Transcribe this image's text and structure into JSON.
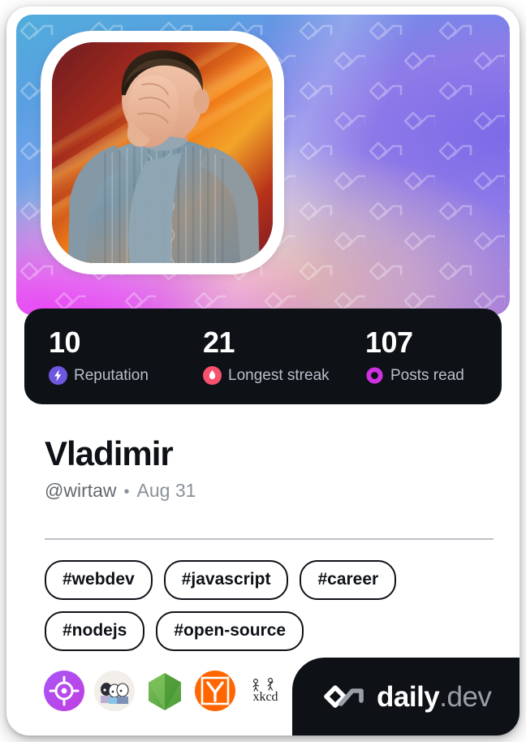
{
  "card": {
    "background_color": "#ffffff",
    "dark_color": "#0e1217"
  },
  "cover": {
    "watermark_icon": "daily-dev-logo-pattern",
    "gradient_colors": [
      "#3fb8d8",
      "#4f95e8",
      "#9a79e2",
      "#e949f5",
      "#ffc496"
    ]
  },
  "avatar": {
    "icon": "user-avatar-photo",
    "alt": "Person facepalming in a cable-knit sweater"
  },
  "stats": [
    {
      "value": "10",
      "label": "Reputation",
      "icon": "bolt-icon",
      "color": "#6e57e0"
    },
    {
      "value": "21",
      "label": "Longest streak",
      "icon": "flame-icon",
      "color": "#f8516d"
    },
    {
      "value": "107",
      "label": "Posts read",
      "icon": "ring-icon",
      "color": "#cf31e0"
    }
  ],
  "identity": {
    "display_name": "Vladimir",
    "handle": "@wirtaw",
    "separator": "•",
    "joined": "Aug 31"
  },
  "tags": [
    {
      "label": "#webdev"
    },
    {
      "label": "#javascript"
    },
    {
      "label": "#career"
    },
    {
      "label": "#nodejs"
    },
    {
      "label": "#open-source"
    }
  ],
  "sources": [
    {
      "name": "target-source-icon",
      "title": "Source 1"
    },
    {
      "name": "css-tricks-source-icon",
      "title": "CSS-Tricks"
    },
    {
      "name": "nodejs-source-icon",
      "title": "Node.js"
    },
    {
      "name": "hacker-news-source-icon",
      "title": "Hacker News"
    },
    {
      "name": "xkcd-source-icon",
      "title": "xkcd"
    }
  ],
  "brand": {
    "name": "daily",
    "suffix": ".dev",
    "logo_icon": "daily-dev-logo"
  }
}
